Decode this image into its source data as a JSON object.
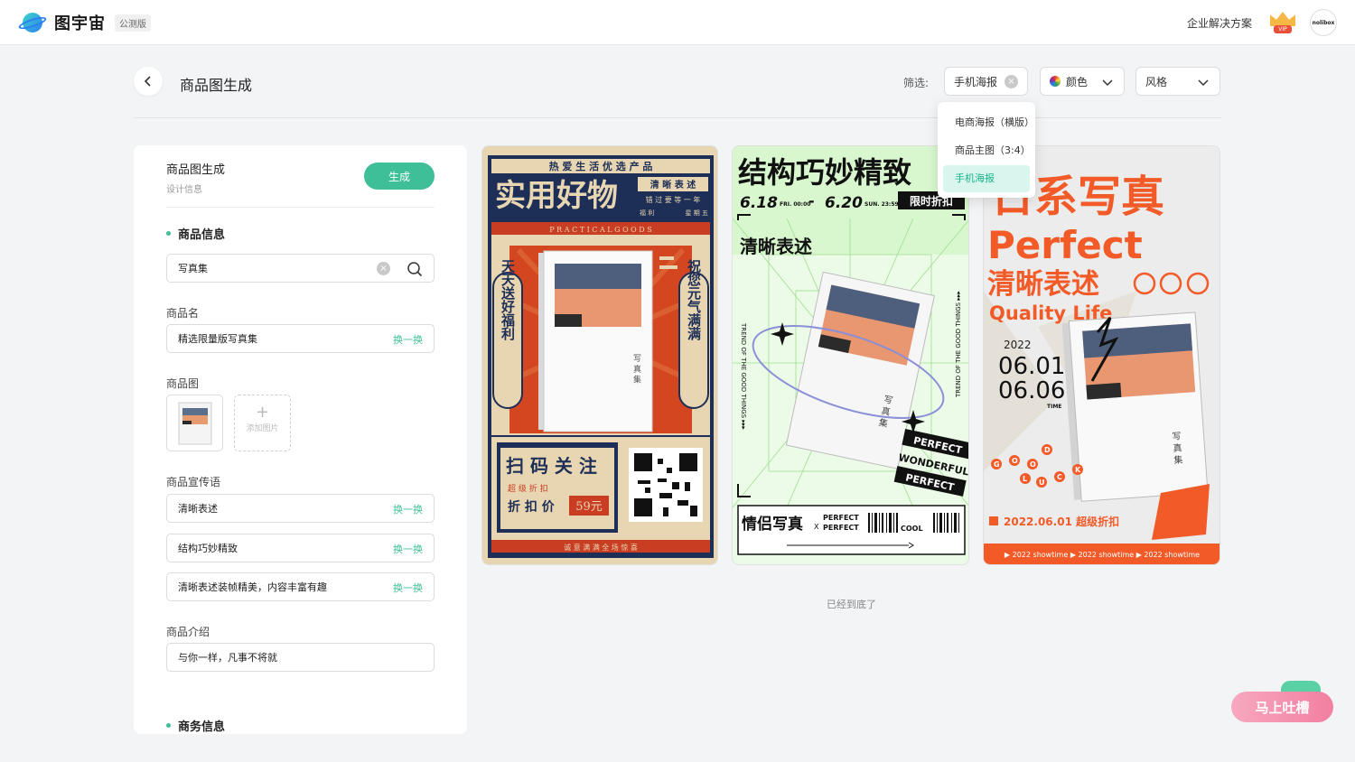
{
  "app": {
    "name": "图宇宙",
    "tag": "公测版"
  },
  "topbar": {
    "enterprise": "企业解决方案",
    "vip_label": "VIP",
    "avatar_text": "nolibox"
  },
  "header": {
    "title": "商品图生成",
    "filter_label": "筛选:",
    "filter_type": "手机海报",
    "filter_color": "颜色",
    "filter_style": "风格"
  },
  "dropdown": {
    "options": [
      "电商海报（横版）",
      "商品主图（3:4）",
      "手机海报"
    ],
    "selected": "手机海报"
  },
  "panel": {
    "title": "商品图生成",
    "subtitle": "设计信息",
    "generate": "生成",
    "section_product": "商品信息",
    "search_value": "写真集",
    "name_label": "商品名",
    "name_value": "精选限量版写真集",
    "swap": "换一换",
    "image_label": "商品图",
    "add_image": "添加图片",
    "slogan_label": "商品宣传语",
    "slogans": [
      "清晰表述",
      "结构巧妙精致",
      "清晰表述装帧精美，内容丰富有趣"
    ],
    "intro_label": "商品介绍",
    "intro_value": "与你一样，凡事不将就",
    "section_business": "商务信息"
  },
  "poster1": {
    "top_strip": "热 爱 生 活 优 选 产 品",
    "headline": "实用好物",
    "tag1": "清 晰 表 述",
    "tag2": "错 过 要 等 一 年",
    "tag3a": "福 利",
    "tag3b": "星 期 五",
    "en": "P R A C T I C A L   G O O D S",
    "left_vertical": "天天送好福利",
    "right_vertical": "祝您元气满满",
    "book_title": "写 真 集",
    "scan": "扫 码 关 注",
    "discount": "超 级 折 扣",
    "price_label": "折 扣 价",
    "price": "59元",
    "bottom": "诚 意 满 满 全 场 惊 喜"
  },
  "poster2": {
    "headline": "结构巧妙精致",
    "date1": "6.18",
    "date1_sub": "FRI. 00:00",
    "dash": "-",
    "date2": "6.20",
    "date2_sub": "SUN. 23:59",
    "badge": "限时折扣",
    "subtitle": "清晰表述",
    "side_left": "TREND OF THE GOOD THINGS ▸▸▸",
    "side_right": "TREND OF THE GOOD THINGS ▸▸▸",
    "stamp1": "PERFECT",
    "stamp2": "WONDERFUL",
    "stamp3": "PERFECT",
    "book_title": "写 真 集",
    "footer_cn": "情侣写真",
    "footer_x": "X",
    "footer_en1": "PERFECT",
    "footer_en2": "PERFECT",
    "footer_cool": "COOL"
  },
  "poster3": {
    "headline": "日系写真",
    "en1": "Perfect",
    "cn2": "清晰表述",
    "en2": "Quality Life",
    "year": "2022",
    "d1": "06.01",
    "d2": "06.06",
    "time": "TIME",
    "goodluck": [
      "G",
      "O",
      "O",
      "D",
      "L",
      "U",
      "C",
      "K"
    ],
    "book_title": "写 真 集",
    "promo": "2022.06.01 超级折扣",
    "footer": "▶ 2022 showtime   ▶ 2022 showtime   ▶ 2022 showtime"
  },
  "bottom_note": "已经到底了",
  "feedback": "马上吐槽",
  "colors": {
    "accent": "#3fbf98",
    "poster1_bg": "#1d2f57",
    "poster2_bg": "#c9f5c2",
    "poster3_accent": "#f25a28"
  }
}
